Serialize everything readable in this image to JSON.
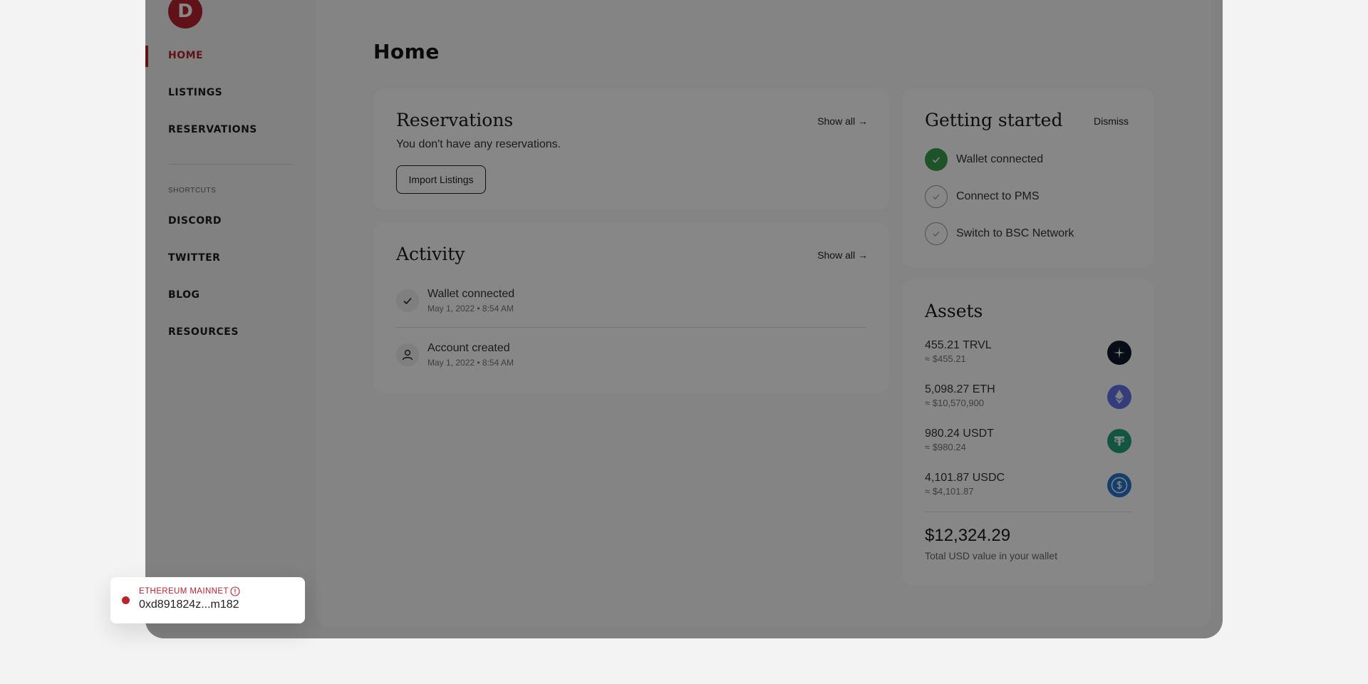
{
  "sidebar": {
    "logo_letter": "D",
    "nav": [
      {
        "label": "HOME",
        "active": true
      },
      {
        "label": "LISTINGS",
        "active": false
      },
      {
        "label": "RESERVATIONS",
        "active": false
      }
    ],
    "shortcuts_heading": "SHORTCUTS",
    "shortcuts": [
      {
        "label": "DISCORD"
      },
      {
        "label": "TWITTER"
      },
      {
        "label": "BLOG"
      },
      {
        "label": "RESOURCES"
      }
    ]
  },
  "main": {
    "page_title": "Home",
    "reservations": {
      "title": "Reservations",
      "show_all": "Show all →",
      "empty_text": "You don't have any reservations.",
      "import_button": "Import Listings"
    },
    "activity": {
      "title": "Activity",
      "show_all": "Show all →",
      "items": [
        {
          "icon": "check-icon",
          "label": "Wallet connected",
          "timestamp": "May 1, 2022 • 8:54 AM"
        },
        {
          "icon": "user-icon",
          "label": "Account created",
          "timestamp": "May 1, 2022 • 8:54 AM"
        }
      ]
    },
    "getting_started": {
      "title": "Getting started",
      "dismiss": "Dismiss",
      "steps": [
        {
          "label": "Wallet connected",
          "done": true
        },
        {
          "label": "Connect to PMS",
          "done": false
        },
        {
          "label": "Switch to BSC Network",
          "done": false
        }
      ]
    },
    "assets": {
      "title": "Assets",
      "items": [
        {
          "amount": "455.21 TRVL",
          "usd": "≈ $455.21",
          "icon": "trvl-icon",
          "color": "#0e1a2b"
        },
        {
          "amount": "5,098.27 ETH",
          "usd": "≈ $10,570,900",
          "icon": "ethereum-icon",
          "color": "#6274e6"
        },
        {
          "amount": "980.24 USDT",
          "usd": "≈ $980.24",
          "icon": "tether-icon",
          "color": "#26a17b"
        },
        {
          "amount": "4,101.87 USDC",
          "usd": "≈ $4,101.87",
          "icon": "usdc-icon",
          "color": "#2775ca"
        }
      ],
      "total": "$12,324.29",
      "total_label": "Total USD value in your wallet"
    }
  },
  "network": {
    "name": "ETHEREUM MAINNET",
    "address": "0xd891824z...m182",
    "status_color": "#b8232e"
  },
  "colors": {
    "accent": "#b8232e",
    "success": "#3a9b4f"
  }
}
